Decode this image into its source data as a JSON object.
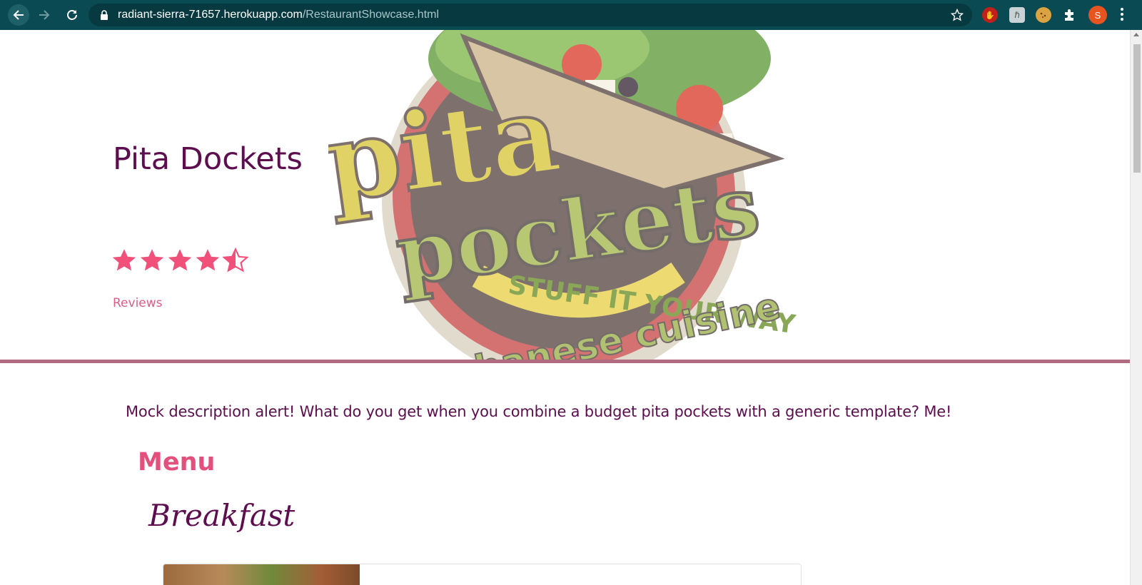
{
  "browser": {
    "url_host": "radiant-sierra-71657.herokuapp.com",
    "url_path": "/RestaurantShowcase.html",
    "profile_initial": "S",
    "extensions": [
      "stop-hand-icon",
      "h-extension-icon",
      "cookie-icon",
      "puzzle-icon"
    ]
  },
  "hero": {
    "title": "Pita Dockets",
    "rating": 4.5,
    "rating_max": 5,
    "reviews_link": "Reviews",
    "logo": {
      "top_word": "pita",
      "main_word": "pockets",
      "tagline": "STUFF IT YOUR WAY",
      "arc_text": "lebanese cuisine"
    }
  },
  "main": {
    "description": "Mock description alert! What do you get when you combine a budget pita pockets with a generic template? Me!",
    "menu_heading": "Menu",
    "section_heading": "Breakfast"
  },
  "colors": {
    "title": "#5c0e4e",
    "accent": "#e4507e",
    "star": "#f0507a",
    "divider": "#b26a80",
    "chrome": "#0a4a52"
  }
}
